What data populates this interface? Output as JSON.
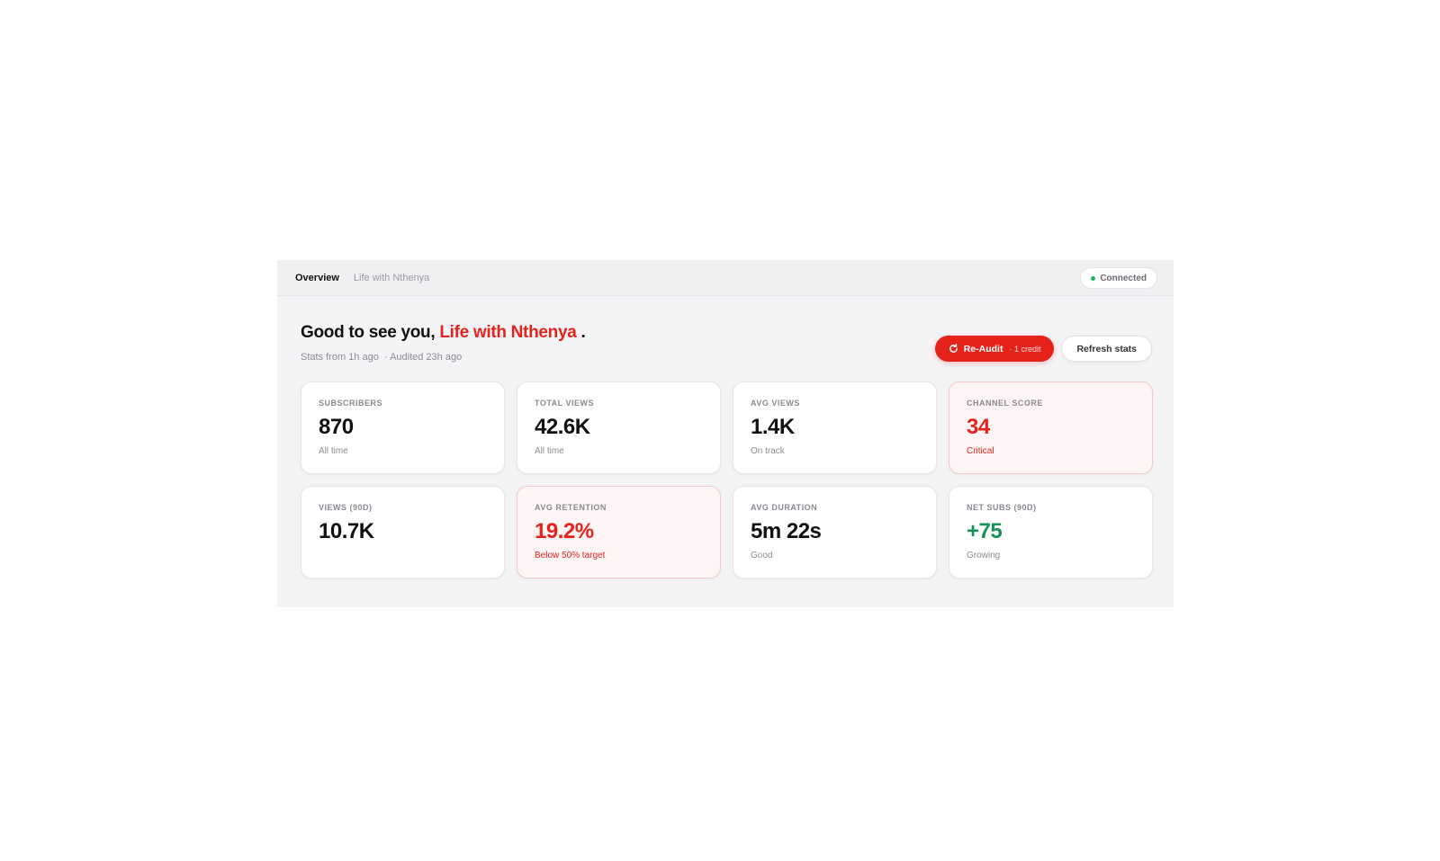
{
  "topbar": {
    "title": "Overview",
    "channel": "Life with Nthenya",
    "status": "Connected",
    "status_color": "#22b35e"
  },
  "header": {
    "greeting_prefix": "Good to see you,",
    "channel_name": "Life with Nthenya",
    "greeting_suffix": " .",
    "stats_age": "Stats from 1h ago",
    "audited": "· Audited 23h ago"
  },
  "actions": {
    "reaudit_label": "Re-Audit",
    "reaudit_credit": "· 1 credit",
    "refresh_label": "Refresh stats"
  },
  "colors": {
    "accent": "#e5231b",
    "positive": "#16915a"
  },
  "cards": [
    {
      "label": "SUBSCRIBERS",
      "value": "870",
      "sub": "All time"
    },
    {
      "label": "TOTAL VIEWS",
      "value": "42.6K",
      "sub": "All time"
    },
    {
      "label": "AVG VIEWS",
      "value": "1.4K",
      "sub": "On track"
    },
    {
      "label": "CHANNEL SCORE",
      "value": "34",
      "sub": "Critical"
    },
    {
      "label": "VIEWS (90D)",
      "value": "10.7K",
      "sub": ""
    },
    {
      "label": "AVG RETENTION",
      "value": "19.2%",
      "sub": "Below 50% target"
    },
    {
      "label": "AVG DURATION",
      "value": "5m 22s",
      "sub": "Good"
    },
    {
      "label": "NET SUBS (90D)",
      "value": "+75",
      "sub": "Growing"
    }
  ]
}
